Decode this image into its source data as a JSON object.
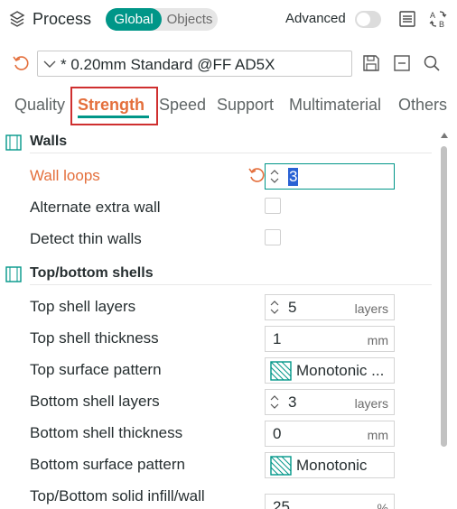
{
  "header": {
    "title": "Process",
    "scope_global": "Global",
    "scope_objects": "Objects",
    "advanced_label": "Advanced",
    "icons": [
      "process-cube-icon",
      "list-icon",
      "compare-icon"
    ],
    "accent_color": "#009688"
  },
  "preset": {
    "name": "* 0.20mm Standard @FF AD5X",
    "icons": [
      "reset-icon",
      "chevron-down-icon",
      "save-icon",
      "minus-icon",
      "search-icon"
    ]
  },
  "tabs": [
    {
      "label": "Quality"
    },
    {
      "label": "Strength"
    },
    {
      "label": "Speed"
    },
    {
      "label": "Support"
    },
    {
      "label": "Multimaterial"
    },
    {
      "label": "Others"
    }
  ],
  "active_tab": "Strength",
  "sections": {
    "walls": {
      "title": "Walls",
      "wall_loops": {
        "label": "Wall loops",
        "value": "3"
      },
      "alternate_extra_wall": {
        "label": "Alternate extra wall",
        "checked": false
      },
      "detect_thin_walls": {
        "label": "Detect thin walls",
        "checked": false
      }
    },
    "shells": {
      "title": "Top/bottom shells",
      "top_shell_layers": {
        "label": "Top shell layers",
        "value": "5",
        "unit": "layers"
      },
      "top_shell_thickness": {
        "label": "Top shell thickness",
        "value": "1",
        "unit": "mm"
      },
      "top_surface_pattern": {
        "label": "Top surface pattern",
        "value": "Monotonic ..."
      },
      "bottom_shell_layers": {
        "label": "Bottom shell layers",
        "value": "3",
        "unit": "layers"
      },
      "bottom_shell_thickness": {
        "label": "Bottom shell thickness",
        "value": "0",
        "unit": "mm"
      },
      "bottom_surface_pattern": {
        "label": "Bottom surface pattern",
        "value": "Monotonic"
      },
      "solid_infill_wall": {
        "label": "Top/Bottom solid infill/wall",
        "value": "25",
        "unit": "%"
      }
    }
  },
  "colors": {
    "modified": "#e46f3c",
    "active_tab": "#e46f3c",
    "highlight_box": "#cf2f2f",
    "selection": "#2a62d4"
  }
}
